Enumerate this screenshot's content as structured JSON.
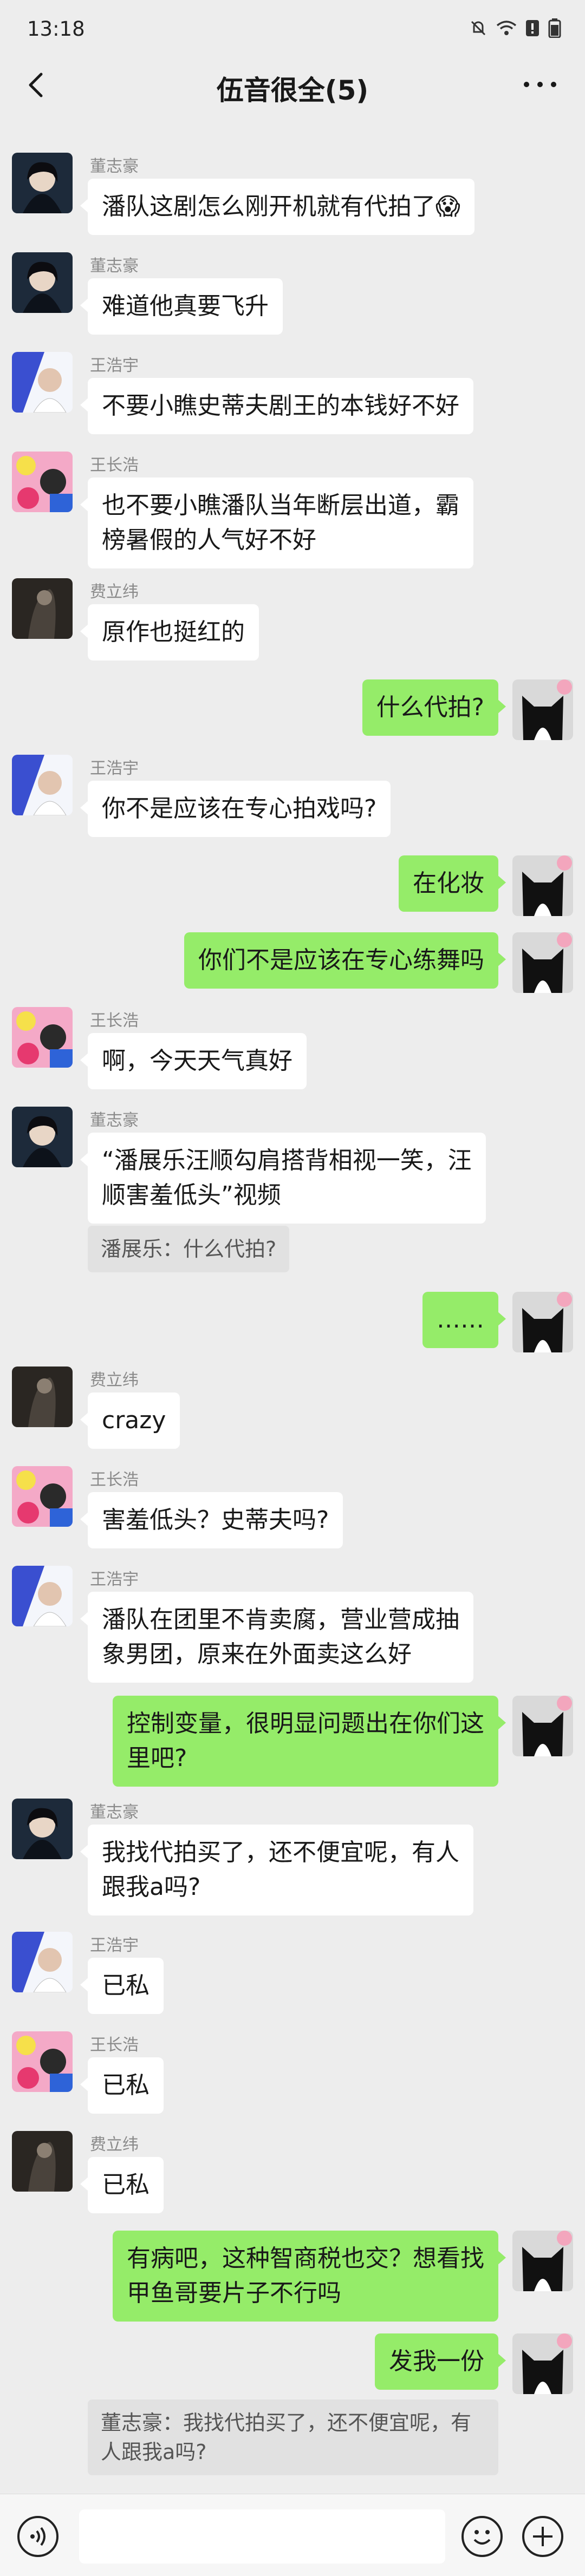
{
  "status_bar": {
    "time": "13:18"
  },
  "header": {
    "title": "伍音很全(5)"
  },
  "messages": [
    {
      "sender": "董志豪",
      "text": "潘队这剧怎么刚开机就有代拍了😱"
    },
    {
      "sender": "董志豪",
      "text": "难道他真要飞升"
    },
    {
      "sender": "王浩宇",
      "text": "不要小瞧史蒂夫剧王的本钱好不好"
    },
    {
      "sender": "王长浩",
      "line1": "也不要小瞧潘队当年断层出道，霸",
      "line2": "榜暑假的人气好不好"
    },
    {
      "sender": "费立纬",
      "text": "原作也挺红的"
    },
    {
      "text": "什么代拍?"
    },
    {
      "sender": "王浩宇",
      "text": "你不是应该在专心拍戏吗?"
    },
    {
      "text": "在化妆"
    },
    {
      "text": "你们不是应该在专心练舞吗"
    },
    {
      "sender": "王长浩",
      "text": "啊，今天天气真好"
    },
    {
      "sender": "董志豪",
      "line1": "“潘展乐汪顺勾肩搭背相视一笑，汪",
      "line2": "顺害羞低头”视频",
      "quote": "潘展乐：什么代拍?"
    },
    {
      "text": "……"
    },
    {
      "sender": "费立纬",
      "text": "crazy"
    },
    {
      "sender": "王长浩",
      "text": "害羞低头？史蒂夫吗?"
    },
    {
      "sender": "王浩宇",
      "line1": "潘队在团里不肯卖腐，营业营成抽",
      "line2": "象男团，原来在外面卖这么好"
    },
    {
      "line1": "控制变量，很明显问题出在你们这",
      "line2": "里吧?"
    },
    {
      "sender": "董志豪",
      "line1": "我找代拍买了，还不便宜呢，有人",
      "line2": "跟我a吗?"
    },
    {
      "sender": "王浩宇",
      "text": "已私"
    },
    {
      "sender": "王长浩",
      "text": "已私"
    },
    {
      "sender": "费立纬",
      "text": "已私"
    },
    {
      "line1": "有病吧，这种智商税也交？想看找",
      "line2": "甲鱼哥要片子不行吗"
    },
    {
      "text": "发我一份",
      "quote_line1": "董志豪：我找代拍买了，还不便宜呢，有",
      "quote_line2": "人跟我a吗?"
    }
  ]
}
